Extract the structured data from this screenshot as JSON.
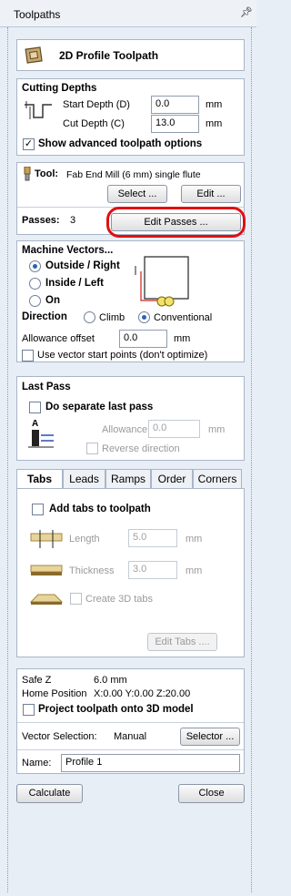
{
  "window": {
    "title": "Toolpaths",
    "pin_glyph": "↕"
  },
  "header": {
    "title": "2D Profile Toolpath",
    "icon": "profile-toolpath-icon"
  },
  "cutting_depths": {
    "title": "Cutting Depths",
    "start_label": "Start Depth (D)",
    "start_value": "0.0",
    "start_unit": "mm",
    "cut_label": "Cut Depth (C)",
    "cut_value": "13.0",
    "cut_unit": "mm",
    "advanced_label": "Show advanced toolpath options",
    "advanced_checked": true
  },
  "tool": {
    "label": "Tool:",
    "name": "Fab End Mill (6 mm) single flute",
    "select_label": "Select ...",
    "edit_label": "Edit ...",
    "passes_label": "Passes:",
    "passes_value": "3",
    "edit_passes_label": "Edit Passes ...",
    "highlight_color": "#e01010"
  },
  "machine_vectors": {
    "title": "Machine Vectors...",
    "options": [
      "Outside / Right",
      "Inside / Left",
      "On"
    ],
    "selected": "Outside / Right",
    "direction_label": "Direction",
    "climb_label": "Climb",
    "conventional_label": "Conventional",
    "direction_selected": "Conventional",
    "allowance_label": "Allowance offset",
    "allowance_value": "0.0",
    "allowance_unit": "mm",
    "start_points_label": "Use vector start points (don't optimize)"
  },
  "last_pass": {
    "title": "Last Pass",
    "separate_label": "Do separate last pass",
    "allowance_label": "Allowance (A)",
    "allowance_value": "0.0",
    "allowance_unit": "mm",
    "reverse_label": "Reverse direction"
  },
  "tabs": {
    "items": [
      "Tabs",
      "Leads",
      "Ramps",
      "Order",
      "Corners"
    ],
    "active": "Tabs",
    "add_label": "Add tabs to toolpath",
    "length_label": "Length",
    "length_value": "5.0",
    "length_unit": "mm",
    "thickness_label": "Thickness",
    "thickness_value": "3.0",
    "thickness_unit": "mm",
    "create3d_label": "Create 3D tabs",
    "edit_tabs_label": "Edit Tabs ...."
  },
  "footer": {
    "safe_z_label": "Safe Z",
    "safe_z_value": "6.0 mm",
    "home_label": "Home Position",
    "home_value": "X:0.00 Y:0.00 Z:20.00",
    "project_label": "Project toolpath onto 3D model",
    "vector_sel_label": "Vector Selection:",
    "vector_sel_value": "Manual",
    "selector_label": "Selector ...",
    "name_label": "Name:",
    "name_value": "Profile 1"
  },
  "actions": {
    "calculate_label": "Calculate",
    "close_label": "Close"
  }
}
